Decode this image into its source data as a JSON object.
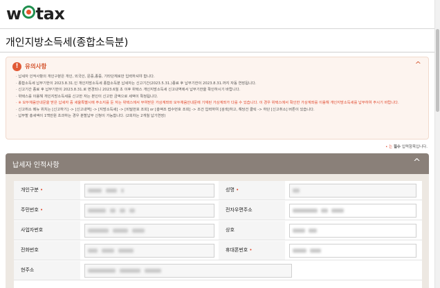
{
  "header": {
    "logo_prefix": "w",
    "logo_suffix": "tax"
  },
  "page": {
    "title": "개인지방소득세(종합소득분)"
  },
  "notice": {
    "title": "유의사항",
    "toggle": "^",
    "items": [
      {
        "text": "납세자 인적사항의 개인구분은 개인, 외국인, 문중,종중, 기타단체로만 입력하셔야 합니다.",
        "red": false
      },
      {
        "text": "종합소득세 납부기한이 2023.8.31.인 개인지방소득세 종합소득분 납세자는 신고기간(2023.5.31.)종료 후 납부기한이 2023.8.31.까지 자동 연장됩니다.",
        "red": false
      },
      {
        "text": "신고기간 종료 후 납부기한이 2023.8.31.로 변경되니 2023.6월 초 이후 위택스 개인지방소득세 신고내역에서 납부기한을 확인하시기 바랍니다.",
        "red": false
      },
      {
        "text": "위택스를 이용해 개인지방소득세를 신고한 자는 본인이 신고한 금액으로 세액이 확정됩니다.",
        "red": false
      },
      {
        "text": "※ 모두채움안내문을 받은 납세자 중 세율특별시에 주소지를 둔 자는 위택스에서 부여받은 가상계좌와 모두채움안내문에 기재된 가상계좌가 다를 수 있습니다. 이 경우 위택스에서 확인한 가상계좌를 이용해 개인지방소득세를 납부하여 주시기 바랍니다.",
        "red": true
      },
      {
        "text": "신고취소 메뉴 위치는 [신고하기] -> [신고내역] -> [지방소득세] -> [비밀번호 조회] or [총액조 접수번호 조회] -> 조건 입력하여 [검색]하고, 해당건 클릭 -> 하단 [신고취소] 버튼이 있습니다.",
        "red": false
      },
      {
        "text": "납부할 총세액이 1백만원 초과하는 경우 분할납부 신청이 가능합니다. (2회차는 2개월 납기연장)",
        "red": false
      }
    ]
  },
  "required_note": {
    "prefix": "• 는 ",
    "bold": "필수",
    "suffix": " 입력항목입니다."
  },
  "section": {
    "title": "납세자 인적사항",
    "toggle": "^"
  },
  "form": {
    "rows": [
      {
        "left_label": "개인구분",
        "left_required": true,
        "right_label": "성명",
        "right_required": true
      },
      {
        "left_label": "주민번호",
        "left_required": true,
        "right_label": "전자우편주소",
        "right_required": false
      },
      {
        "left_label": "사업자번호",
        "left_required": false,
        "right_label": "상호",
        "right_required": false
      },
      {
        "left_label": "전화번호",
        "left_required": false,
        "right_label": "휴대폰번호",
        "right_required": true
      },
      {
        "left_label": "현주소",
        "left_required": false,
        "right_label": "",
        "right_required": false
      }
    ]
  },
  "colors": {
    "accent": "#e15a36",
    "section_header": "#8a8079",
    "logo_green": "#1f8f4e"
  }
}
